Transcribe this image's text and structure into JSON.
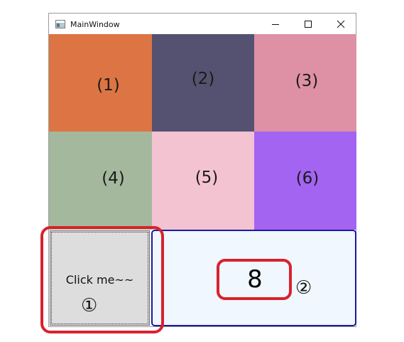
{
  "window": {
    "title": "MainWindow",
    "icons": {
      "app": "app-window-icon",
      "minimize": "minimize-icon",
      "maximize": "maximize-icon",
      "close": "close-icon"
    }
  },
  "grid": {
    "cells": [
      {
        "label": "(1)",
        "color": "#dc7543"
      },
      {
        "label": "(2)",
        "color": "#545270"
      },
      {
        "label": "(3)",
        "color": "#de90a5"
      },
      {
        "label": "(4)",
        "color": "#a4b89d"
      },
      {
        "label": "(5)",
        "color": "#f3c3d1"
      },
      {
        "label": "(6)",
        "color": "#a464f2"
      }
    ]
  },
  "button": {
    "label": "Click me~~"
  },
  "counter": {
    "value": "8",
    "panel_color": "#f0f7ff",
    "border_color": "#1a1aa0"
  },
  "annotations": {
    "marker_1": "①",
    "marker_2": "②",
    "highlight_color": "#d8222c"
  }
}
